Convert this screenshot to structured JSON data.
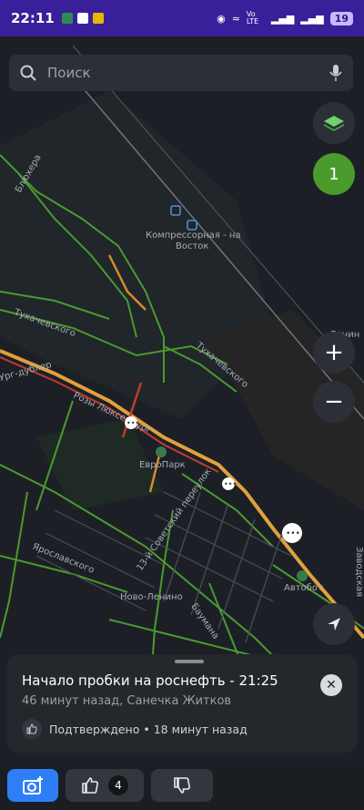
{
  "status_bar": {
    "time": "22:11",
    "network": "Vo LTE",
    "battery": "19"
  },
  "search": {
    "placeholder": "Поиск"
  },
  "map": {
    "labels": [
      "Блюхера",
      "Компрессорная - на",
      "Восток",
      "Тухачевского",
      "Тухачевского",
      "Ург-дублер",
      "Розы Люксембург",
      "ЕвроПарк",
      "Ярославского",
      "13-й Советский переулок",
      "Ново-Ленино",
      "Баумана",
      "Автобот",
      "Ленин",
      "Заводская"
    ],
    "traffic_level": "1"
  },
  "controls": {
    "zoom_in": "+",
    "zoom_out": "−"
  },
  "event_card": {
    "title": "Начало пробки на роснефть - 21:25",
    "subtitle": "46 минут назад, Санечка Житков",
    "confirmed": "Подтверждено • 18 минут назад"
  },
  "actions": {
    "like_count": "4"
  },
  "colors": {
    "accent": "#2e7ff6",
    "traffic_badge": "#4a9b2b",
    "status_bar": "#3a1f9a"
  }
}
